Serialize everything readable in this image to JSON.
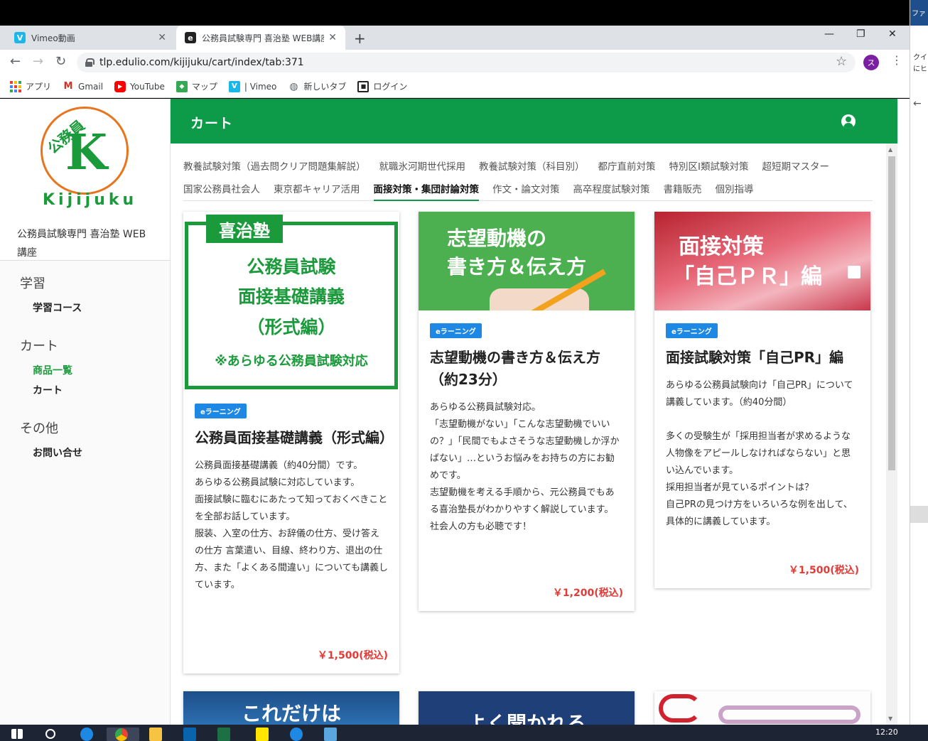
{
  "browser": {
    "tabs": [
      {
        "title": "Vimeo動画",
        "favicon": "V",
        "color": "#1ab7ea"
      },
      {
        "title": "公務員試験専門 喜治塾 WEB講座",
        "favicon": "e",
        "color": "#222222"
      }
    ],
    "url": "tlp.edulio.com/kijijuku/cart/index/tab:371",
    "profile_initial": "ス",
    "bookmarks": [
      "アプリ",
      "Gmail",
      "YouTube",
      "マップ",
      "| Vimeo",
      "新しいタブ",
      "ログイン"
    ]
  },
  "sidebar": {
    "logo_kanji": "公務員",
    "logo_mark": "K",
    "logo_text": "Kijijuku",
    "site_title": "公務員試験専門 喜治塾 WEB講座",
    "groups": [
      {
        "head": "学習",
        "items": [
          {
            "label": "学習コース",
            "active": false
          }
        ]
      },
      {
        "head": "カート",
        "items": [
          {
            "label": "商品一覧",
            "active": true
          },
          {
            "label": "カート",
            "active": false
          }
        ]
      },
      {
        "head": "その他",
        "items": [
          {
            "label": "お問い合せ",
            "active": false
          }
        ]
      }
    ]
  },
  "header": {
    "title": "カート"
  },
  "categories": [
    [
      "教養試験対策（過去問クリア問題集解説）",
      "就職氷河期世代採用",
      "教養試験対策（科目別）",
      "都庁直前対策",
      "特別区Ⅰ類試験対策",
      "超短期マスター"
    ],
    [
      "国家公務員社会人",
      "東京都キャリア活用",
      "面接対策・集団討論対策",
      "作文・論文対策",
      "高卒程度試験対策",
      "書籍販売",
      "個別指導"
    ]
  ],
  "active_category": "面接対策・集団討論対策",
  "products": [
    {
      "image_lines": [
        "喜治塾",
        "公務員試験",
        "面接基礎講義",
        "（形式編）",
        "※あらゆる公務員試験対応"
      ],
      "badge": "eラーニング",
      "title": "公務員面接基礎講義（形式編）",
      "description": "公務員面接基礎講義（約40分間）です。\nあらゆる公務員試験に対応しています。\n面接試験に臨むにあたって知っておくべきことを全部お話しています。\n服装、入室の仕方、お辞儀の仕方、受け答えの仕方 言葉遣い、目線、終わり方、退出の仕方、また「よくある間違い」についても講義しています。",
      "price": "￥1,500(税込)"
    },
    {
      "image_lines": [
        "志望動機の",
        "書き方＆伝え方"
      ],
      "badge": "eラーニング",
      "title": "志望動機の書き方＆伝え方（約23分）",
      "description": "あらゆる公務員試験対応。\n「志望動機がない」「こんな志望動機でいいの？」「民間でもよさそうな志望動機しか浮かばない」…というお悩みをお持ちの方にお勧めです。\n志望動機を考える手順から、元公務員でもある喜治塾長がわかりやすく解説しています。\n社会人の方も必聴です！",
      "price": "￥1,200(税込)"
    },
    {
      "image_lines": [
        "面接対策",
        "「自己ＰＲ」編"
      ],
      "badge": "eラーニング",
      "title": "面接試験対策「自己PR」編",
      "description": "あらゆる公務員試験向け「自己PR」について講義しています。（約40分間）\n\n多くの受験生が「採用担当者が求めるような人物像をアピールしなければならない」と思い込んでいます。\n採用担当者が見ているポイントは？\n自己PRの見つけ方をいろいろな例を出して、具体的に講義しています。",
      "price": "￥1,500(税込)"
    }
  ],
  "next_row_images": [
    "これだけは",
    "よく聞かれる",
    ""
  ],
  "taskbar": {
    "clock": "12:20"
  },
  "outside": {
    "strip": "ファ",
    "l1": "クイ",
    "l2": "にヒ"
  }
}
